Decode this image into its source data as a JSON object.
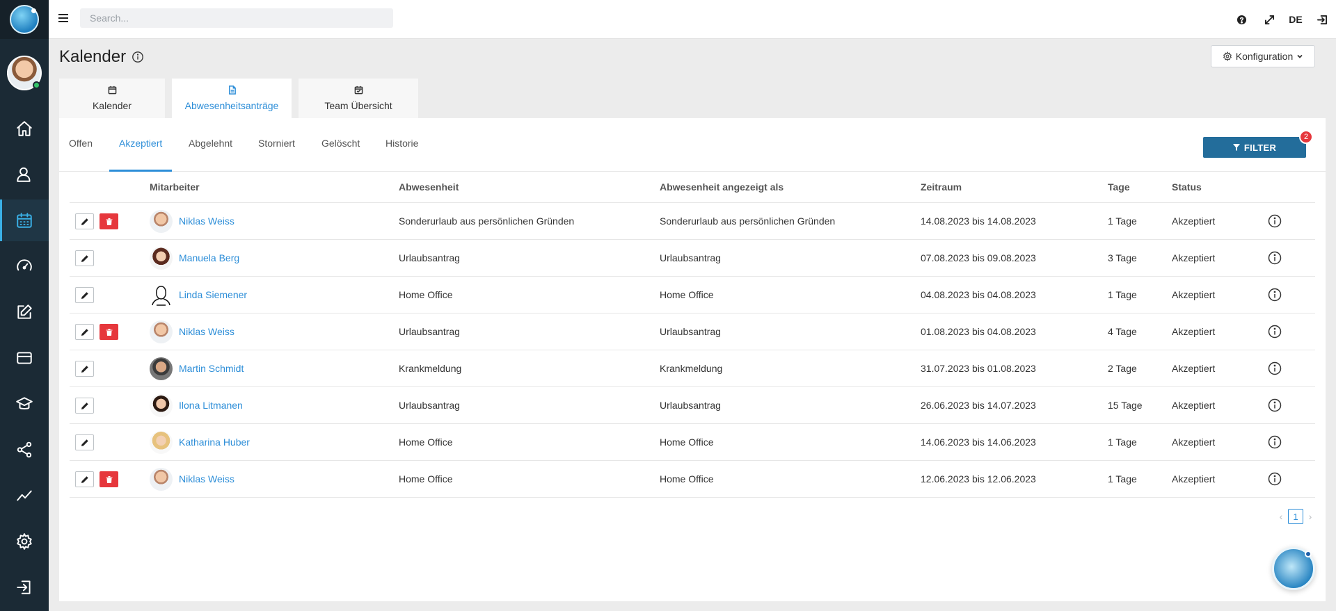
{
  "topbar": {
    "search_placeholder": "Search...",
    "language": "DE"
  },
  "page": {
    "title": "Kalender",
    "config_label": "Konfiguration"
  },
  "main_tabs": [
    {
      "label": "Kalender",
      "icon": "calendar-icon",
      "active": false
    },
    {
      "label": "Abwesenheitsanträge",
      "icon": "document-icon",
      "active": true
    },
    {
      "label": "Team Übersicht",
      "icon": "calendar-check-icon",
      "active": false
    }
  ],
  "sub_tabs": [
    {
      "label": "Offen",
      "active": false
    },
    {
      "label": "Akzeptiert",
      "active": true
    },
    {
      "label": "Abgelehnt",
      "active": false
    },
    {
      "label": "Storniert",
      "active": false
    },
    {
      "label": "Gelöscht",
      "active": false
    },
    {
      "label": "Historie",
      "active": false
    }
  ],
  "filter": {
    "label": "FILTER",
    "badge": "2"
  },
  "table": {
    "headers": {
      "mitarbeiter": "Mitarbeiter",
      "abwesenheit": "Abwesenheit",
      "angezeigt": "Abwesenheit angezeigt als",
      "zeitraum": "Zeitraum",
      "tage": "Tage",
      "status": "Status"
    },
    "rows": [
      {
        "name": "Niklas Weiss",
        "abwesenheit": "Sonderurlaub aus persönlichen Gründen",
        "angezeigt": "Sonderurlaub aus persönlichen Gründen",
        "zeitraum": "14.08.2023 bis 14.08.2023",
        "tage": "1 Tage",
        "status": "Akzeptiert"
      },
      {
        "name": "Manuela Berg",
        "abwesenheit": "Urlaubsantrag",
        "angezeigt": "Urlaubsantrag",
        "zeitraum": "07.08.2023 bis 09.08.2023",
        "tage": "3 Tage",
        "status": "Akzeptiert"
      },
      {
        "name": "Linda Siemener",
        "abwesenheit": "Home Office",
        "angezeigt": "Home Office",
        "zeitraum": "04.08.2023 bis 04.08.2023",
        "tage": "1 Tage",
        "status": "Akzeptiert"
      },
      {
        "name": "Niklas Weiss",
        "abwesenheit": "Urlaubsantrag",
        "angezeigt": "Urlaubsantrag",
        "zeitraum": "01.08.2023 bis 04.08.2023",
        "tage": "4 Tage",
        "status": "Akzeptiert"
      },
      {
        "name": "Martin Schmidt",
        "abwesenheit": "Krankmeldung",
        "angezeigt": "Krankmeldung",
        "zeitraum": "31.07.2023 bis 01.08.2023",
        "tage": "2 Tage",
        "status": "Akzeptiert"
      },
      {
        "name": "Ilona Litmanen",
        "abwesenheit": "Urlaubsantrag",
        "angezeigt": "Urlaubsantrag",
        "zeitraum": "26.06.2023 bis 14.07.2023",
        "tage": "15 Tage",
        "status": "Akzeptiert"
      },
      {
        "name": "Katharina Huber",
        "abwesenheit": "Home Office",
        "angezeigt": "Home Office",
        "zeitraum": "14.06.2023 bis 14.06.2023",
        "tage": "1 Tage",
        "status": "Akzeptiert"
      },
      {
        "name": "Niklas Weiss",
        "abwesenheit": "Home Office",
        "angezeigt": "Home Office",
        "zeitraum": "12.06.2023 bis 12.06.2023",
        "tage": "1 Tage",
        "status": "Akzeptiert"
      }
    ]
  },
  "pagination": {
    "prev": "‹",
    "current": "1",
    "next": "›"
  },
  "colors": {
    "sidebar": "#1b2a35",
    "accent": "#2d8ed8",
    "filter_button": "#236d9b",
    "delete": "#e6373c"
  }
}
